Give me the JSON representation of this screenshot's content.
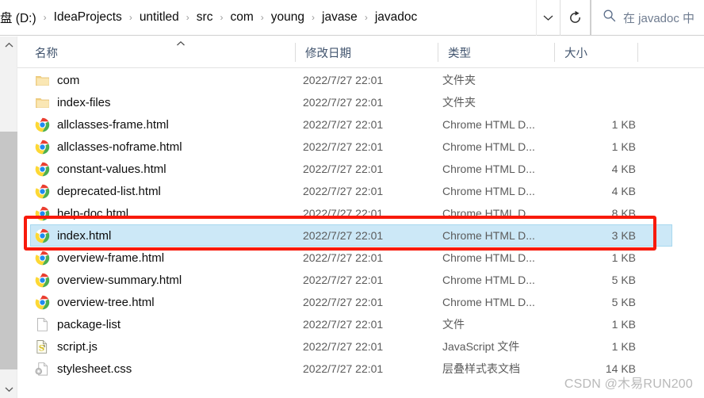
{
  "window": {
    "address_bar": {
      "crumbs": [
        "盘 (D:)",
        "IdeaProjects",
        "untitled",
        "src",
        "com",
        "young",
        "javase",
        "javadoc"
      ],
      "dropdown_icon": "chevron-down-icon",
      "refresh_icon": "refresh-icon",
      "separator": "›"
    },
    "search": {
      "icon": "search-icon",
      "placeholder": "在 javadoc 中"
    }
  },
  "scrollbar": {
    "up_arrow": "chevron-up-icon",
    "down_arrow": "chevron-down-icon"
  },
  "columns": {
    "name": "名称",
    "date": "修改日期",
    "type": "类型",
    "size": "大小",
    "sort_caret": "▲"
  },
  "files": [
    {
      "name": "com",
      "icon": "folder-icon",
      "date": "2022/7/27 22:01",
      "type": "文件夹",
      "size": "",
      "selected": false
    },
    {
      "name": "index-files",
      "icon": "folder-icon",
      "date": "2022/7/27 22:01",
      "type": "文件夹",
      "size": "",
      "selected": false
    },
    {
      "name": "allclasses-frame.html",
      "icon": "chrome-icon",
      "date": "2022/7/27 22:01",
      "type": "Chrome HTML D...",
      "size": "1 KB",
      "selected": false
    },
    {
      "name": "allclasses-noframe.html",
      "icon": "chrome-icon",
      "date": "2022/7/27 22:01",
      "type": "Chrome HTML D...",
      "size": "1 KB",
      "selected": false
    },
    {
      "name": "constant-values.html",
      "icon": "chrome-icon",
      "date": "2022/7/27 22:01",
      "type": "Chrome HTML D...",
      "size": "4 KB",
      "selected": false
    },
    {
      "name": "deprecated-list.html",
      "icon": "chrome-icon",
      "date": "2022/7/27 22:01",
      "type": "Chrome HTML D...",
      "size": "4 KB",
      "selected": false
    },
    {
      "name": "help-doc.html",
      "icon": "chrome-icon",
      "date": "2022/7/27 22:01",
      "type": "Chrome HTML D...",
      "size": "8 KB",
      "selected": false
    },
    {
      "name": "index.html",
      "icon": "chrome-icon",
      "date": "2022/7/27 22:01",
      "type": "Chrome HTML D...",
      "size": "3 KB",
      "selected": true
    },
    {
      "name": "overview-frame.html",
      "icon": "chrome-icon",
      "date": "2022/7/27 22:01",
      "type": "Chrome HTML D...",
      "size": "1 KB",
      "selected": false
    },
    {
      "name": "overview-summary.html",
      "icon": "chrome-icon",
      "date": "2022/7/27 22:01",
      "type": "Chrome HTML D...",
      "size": "5 KB",
      "selected": false
    },
    {
      "name": "overview-tree.html",
      "icon": "chrome-icon",
      "date": "2022/7/27 22:01",
      "type": "Chrome HTML D...",
      "size": "5 KB",
      "selected": false
    },
    {
      "name": "package-list",
      "icon": "blank-file-icon",
      "date": "2022/7/27 22:01",
      "type": "文件",
      "size": "1 KB",
      "selected": false
    },
    {
      "name": "script.js",
      "icon": "js-file-icon",
      "date": "2022/7/27 22:01",
      "type": "JavaScript 文件",
      "size": "1 KB",
      "selected": false
    },
    {
      "name": "stylesheet.css",
      "icon": "css-file-icon",
      "date": "2022/7/27 22:01",
      "type": "层叠样式表文档",
      "size": "14 KB",
      "selected": false
    }
  ],
  "annotation": {
    "highlight_color": "#f81a0b",
    "target_row": "index.html"
  },
  "watermark": {
    "text": "CSDN @木易RUN200"
  }
}
